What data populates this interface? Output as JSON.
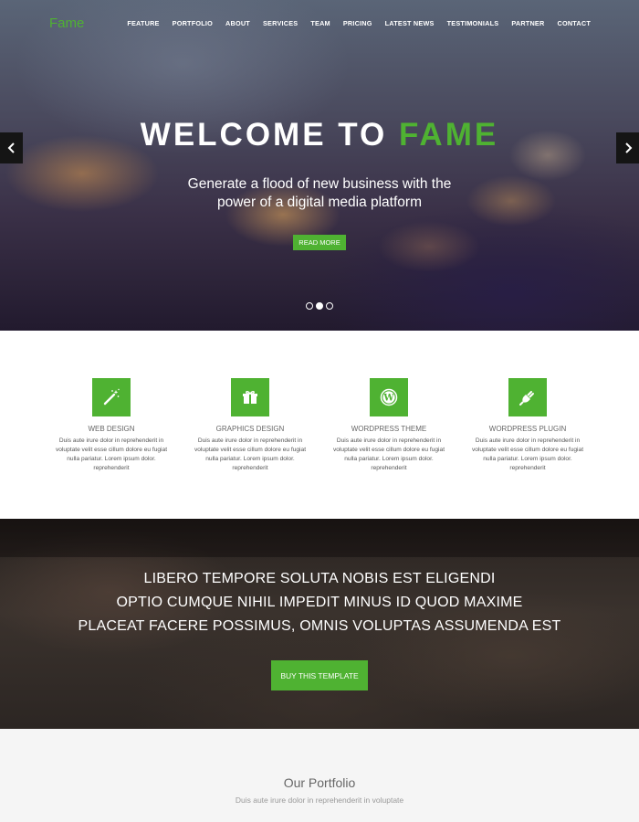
{
  "brand": {
    "name": "Fame",
    "accent_color": "#4fb232"
  },
  "nav": {
    "items": [
      "FEATURE",
      "PORTFOLIO",
      "ABOUT",
      "SERVICES",
      "TEAM",
      "PRICING",
      "LATEST NEWS",
      "TESTIMONIALS",
      "PARTNER",
      "CONTACT"
    ]
  },
  "hero": {
    "title_prefix": "WELCOME TO ",
    "title_accent": "FAME",
    "subtitle_line1": "Generate a flood of new business with the",
    "subtitle_line2": "power of a digital media platform",
    "button_label": "READ MORE",
    "prev_icon": "chevron-left-icon",
    "next_icon": "chevron-right-icon",
    "slides_count": 3,
    "active_slide": 2
  },
  "services": [
    {
      "icon": "magic-wand-icon",
      "title": "WEB DESIGN",
      "text": "Duis aute irure dolor in reprehenderit in voluptate velit esse cillum dolore eu fugiat nulla pariatur. Lorem ipsum dolor. reprehenderit"
    },
    {
      "icon": "gift-icon",
      "title": "GRAPHICS DESIGN",
      "text": "Duis aute irure dolor in reprehenderit in voluptate velit esse cillum dolore eu fugiat nulla pariatur. Lorem ipsum dolor. reprehenderit"
    },
    {
      "icon": "wordpress-icon",
      "title": "WORDPRESS THEME",
      "text": "Duis aute irure dolor in reprehenderit in voluptate velit esse cillum dolore eu fugiat nulla pariatur. Lorem ipsum dolor. reprehenderit"
    },
    {
      "icon": "plug-icon",
      "title": "WORDPRESS PLUGIN",
      "text": "Duis aute irure dolor in reprehenderit in voluptate velit esse cillum dolore eu fugiat nulla pariatur. Lorem ipsum dolor. reprehenderit"
    }
  ],
  "promo": {
    "lines": [
      "LIBERO TEMPORE SOLUTA NOBIS EST ELIGENDI",
      "OPTIO CUMQUE NIHIL IMPEDIT MINUS ID QUOD MAXIME",
      "PLACEAT FACERE POSSIMUS, OMNIS VOLUPTAS ASSUMENDA EST"
    ],
    "button_label": "BUY THIS TEMPLATE"
  },
  "portfolio": {
    "title": "Our Portfolio",
    "subtitle": "Duis aute irure dolor in reprehenderit in voluptate"
  }
}
